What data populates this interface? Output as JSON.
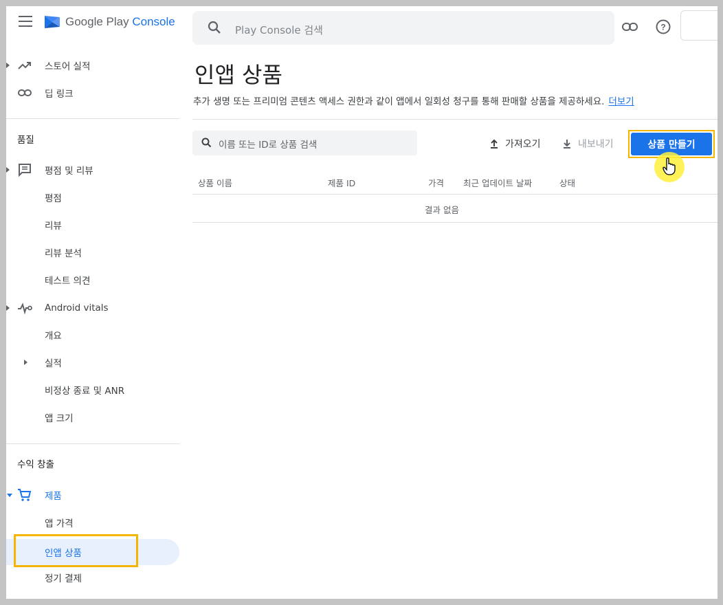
{
  "app": {
    "logo_google": "Google Play",
    "logo_console": "Console"
  },
  "topbar": {
    "search_placeholder": "Play Console 검색"
  },
  "sidebar": {
    "items_top": [
      {
        "label": "스토어 실적"
      },
      {
        "label": "딥 링크"
      }
    ],
    "section_quality": "품질",
    "quality": {
      "ratings_reviews": "평점 및 리뷰",
      "ratings": "평점",
      "reviews": "리뷰",
      "review_analysis": "리뷰 분석",
      "test_feedback": "테스트 의견",
      "android_vitals": "Android vitals",
      "overview": "개요",
      "performance": "실적",
      "crashes_anr": "비정상 종료 및 ANR",
      "app_size": "앱 크기"
    },
    "section_monetize": "수익 창출",
    "monetize": {
      "products": "제품",
      "app_pricing": "앱 가격",
      "in_app_products": "인앱 상품",
      "subscriptions": "정기 결제"
    }
  },
  "main": {
    "title": "인앱 상품",
    "description": "추가 생명 또는 프리미엄 콘텐츠 액세스 권한과 같이 앱에서 일회성 청구를 통해 판매할 상품을 제공하세요.",
    "learn_more": "더보기",
    "search_placeholder": "이름 또는 ID로 상품 검색",
    "import_label": "가져오기",
    "export_label": "내보내기",
    "create_label": "상품 만들기",
    "table_headers": [
      "상품 이름",
      "제품 ID",
      "가격",
      "최근 업데이트 날짜",
      "상태"
    ],
    "empty_text": "결과 없음"
  },
  "colors": {
    "accent": "#1a73e8",
    "highlight": "#f4b400",
    "selected_bg": "#e8f0fe"
  }
}
